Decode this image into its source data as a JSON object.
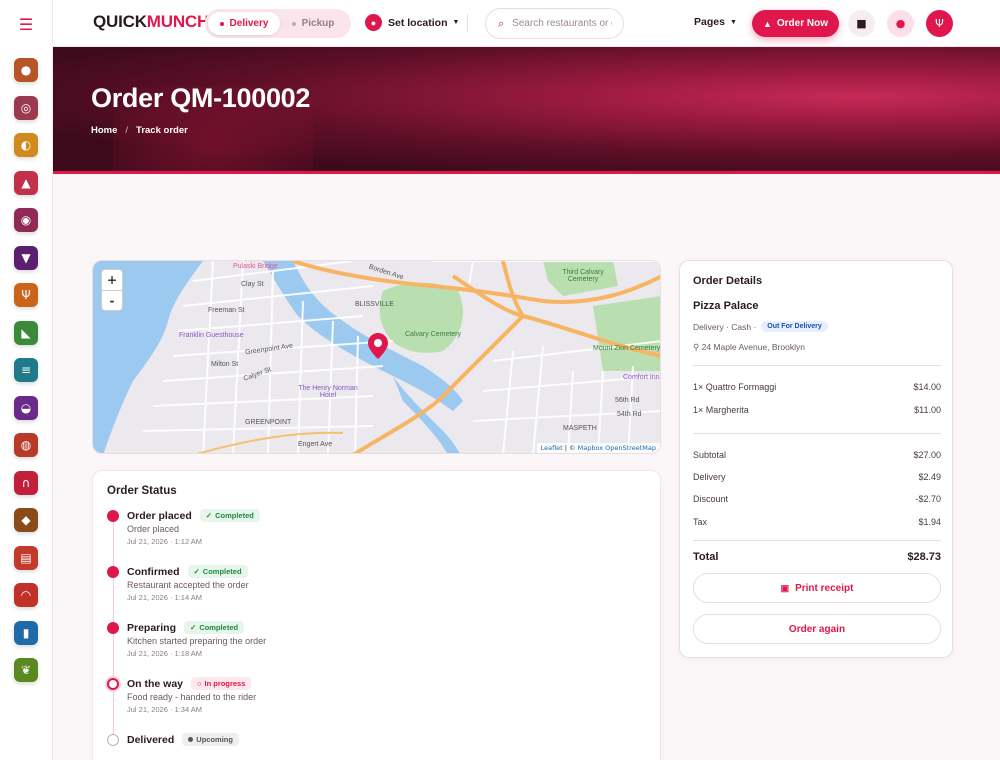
{
  "brand": {
    "logo_main": "QUICK",
    "logo_accent": "MUNCH.",
    "accent_color": "#e0174c"
  },
  "sidebar": {
    "menu_icon": "hamburger-icon",
    "categories": [
      {
        "name": "bread",
        "glyph": "●",
        "color": "#b8542a"
      },
      {
        "name": "donut",
        "glyph": "◎",
        "color": "#9b3a4e"
      },
      {
        "name": "burger-bowl",
        "glyph": "◐",
        "color": "#d18a1c"
      },
      {
        "name": "cake",
        "glyph": "▲",
        "color": "#c2304a"
      },
      {
        "name": "dessert",
        "glyph": "◉",
        "color": "#8e2a55"
      },
      {
        "name": "wine",
        "glyph": "▼",
        "color": "#5a1f6e"
      },
      {
        "name": "cutlery",
        "glyph": "Ψ",
        "color": "#c9641a"
      },
      {
        "name": "pizza",
        "glyph": "◣",
        "color": "#3a8a3a"
      },
      {
        "name": "sandwich",
        "glyph": "≡",
        "color": "#1f7a8a"
      },
      {
        "name": "burger",
        "glyph": "◒",
        "color": "#6a2a8a"
      },
      {
        "name": "steak",
        "glyph": "◍",
        "color": "#b83a2a"
      },
      {
        "name": "shrimp",
        "glyph": "∩",
        "color": "#c21f3a"
      },
      {
        "name": "nuts",
        "glyph": "◆",
        "color": "#8a4a1a"
      },
      {
        "name": "menu-card",
        "glyph": "▤",
        "color": "#c23a2a"
      },
      {
        "name": "taco",
        "glyph": "◠",
        "color": "#c2302a"
      },
      {
        "name": "drink",
        "glyph": "▮",
        "color": "#1f6aa8"
      },
      {
        "name": "leaf",
        "glyph": "❦",
        "color": "#5a8a1f"
      }
    ]
  },
  "topbar": {
    "mode_options": [
      "Delivery",
      "Pickup"
    ],
    "set_location_label": "Set location",
    "search_placeholder": "Search restaurants or dishes",
    "pages_label": "Pages",
    "order_now_label": "Order Now"
  },
  "hero": {
    "title": "Order QM-100002",
    "breadcrumb": [
      "Home",
      "Track order"
    ]
  },
  "map": {
    "zoom_in": "+",
    "zoom_out": "-",
    "attribution_leaflet": "Leaflet",
    "attribution_sep": " | © ",
    "attribution_maptiler": "Mapbox",
    "attribution_osm": "OpenStreetMap",
    "labels": {
      "pulaski_bridge": "Pulaski Bridge",
      "borden_ave": "Borden Ave",
      "third_calvary": "Third Calvary Cemetery",
      "blissville": "BLISSVILLE",
      "calvary_cemetery": "Calvary Cemetery",
      "franklin_guesthouse": "Franklin Guesthouse",
      "greenpoint_ave": "Greenpoint Ave",
      "henry_norman": "The Henry Norman Hotel",
      "greenpoint": "GREENPOINT",
      "mount_zion": "Mount Zion Cemetery",
      "maspeth": "MASPETH",
      "clay_st": "Clay St",
      "freeman_st": "Freeman St",
      "milton_st": "Milton St",
      "calyer_st": "Calyer St",
      "engert_ave": "Engert Ave",
      "comfort_inn": "Comfort Inn",
      "st_56th": "56th Rd",
      "st_54th": "54th Rd"
    }
  },
  "order_status": {
    "heading": "Order Status",
    "steps": [
      {
        "title": "Order placed",
        "badge": "Completed",
        "state": "done",
        "desc": "Order placed",
        "time": "Jul 21, 2026 · 1:12 AM"
      },
      {
        "title": "Confirmed",
        "badge": "Completed",
        "state": "done",
        "desc": "Restaurant accepted the order",
        "time": "Jul 21, 2026 · 1:14 AM"
      },
      {
        "title": "Preparing",
        "badge": "Completed",
        "state": "done",
        "desc": "Kitchen started preparing the order",
        "time": "Jul 21, 2026 · 1:18 AM"
      },
      {
        "title": "On the way",
        "badge": "In progress",
        "state": "prog",
        "desc": "Food ready - handed to the rider",
        "time": "Jul 21, 2026 · 1:34 AM"
      },
      {
        "title": "Delivered",
        "badge": "Upcoming",
        "state": "up",
        "desc": "",
        "time": ""
      }
    ]
  },
  "order_details": {
    "heading": "Order Details",
    "restaurant": "Pizza Palace",
    "meta": "Delivery · Cash ·",
    "status_badge": "Out For Delivery",
    "address": "24 Maple Avenue, Brooklyn",
    "items": [
      {
        "name": "1× Quattro Formaggi",
        "price": "$14.00"
      },
      {
        "name": "1× Margherita",
        "price": "$11.00"
      }
    ],
    "summary": [
      {
        "label": "Subtotal",
        "value": "$27.00"
      },
      {
        "label": "Delivery",
        "value": "$2.49"
      },
      {
        "label": "Discount",
        "value": "-$2.70"
      },
      {
        "label": "Tax",
        "value": "$1.94"
      }
    ],
    "total_label": "Total",
    "total_value": "$28.73",
    "print_label": "Print receipt",
    "again_label": "Order again"
  }
}
